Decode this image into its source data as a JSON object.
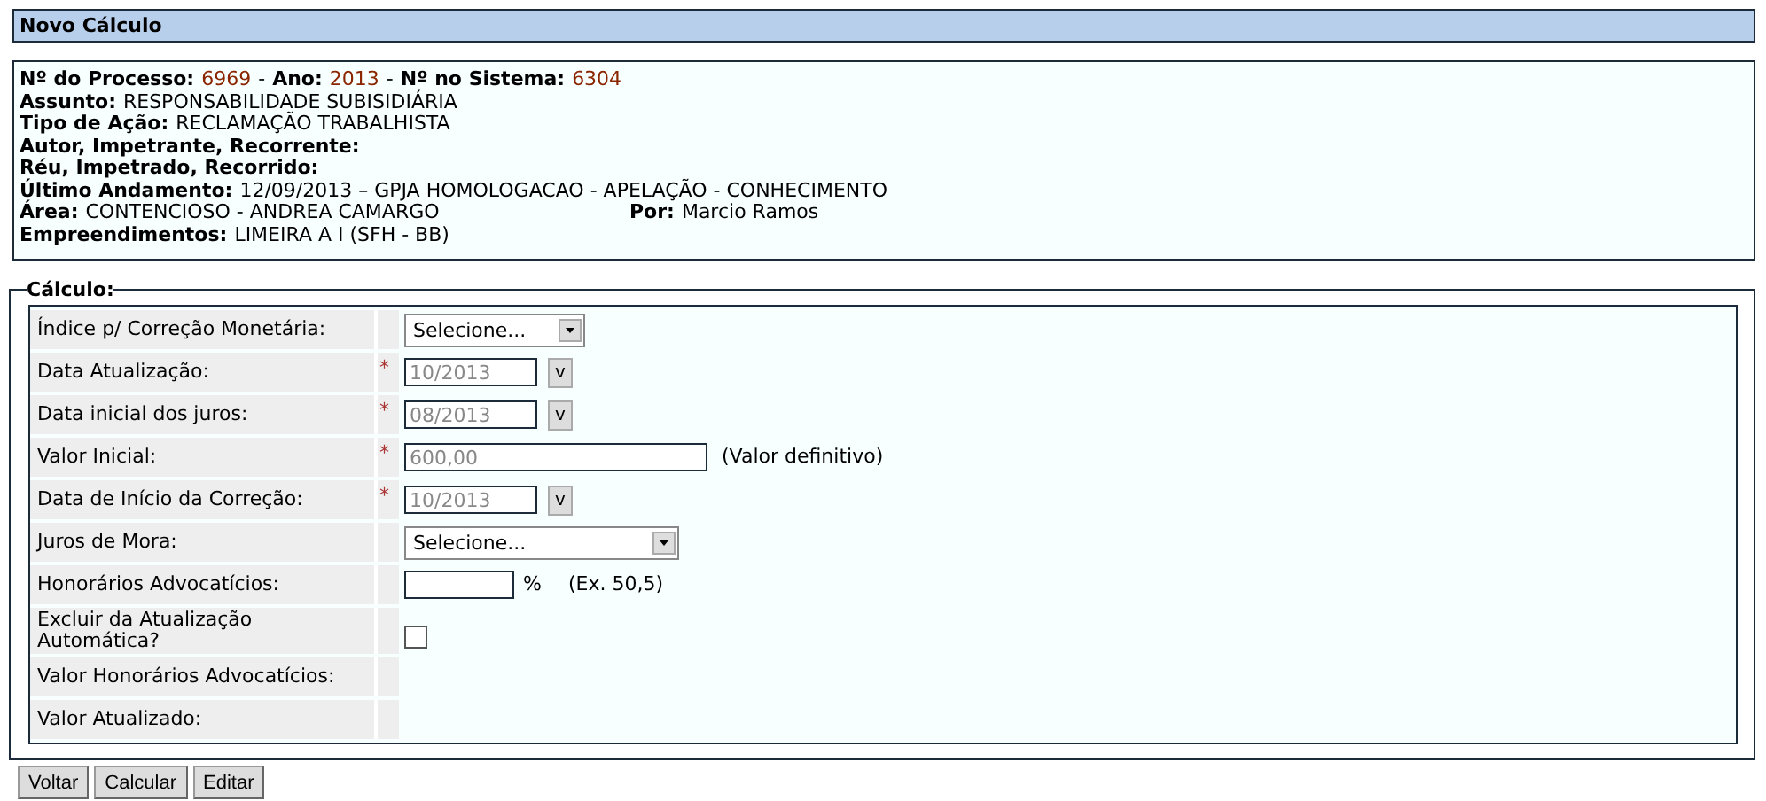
{
  "header": {
    "title": "Novo Cálculo"
  },
  "info": [
    {
      "parts": [
        {
          "kind": "label",
          "text": "Nº do Processo:"
        },
        {
          "kind": "ref",
          "text": "6969"
        },
        {
          "kind": "sep",
          "text": "-"
        },
        {
          "kind": "label",
          "text": "Ano:"
        },
        {
          "kind": "ref",
          "text": "2013"
        },
        {
          "kind": "sep",
          "text": "-"
        },
        {
          "kind": "label",
          "text": "Nº no Sistema:"
        },
        {
          "kind": "ref",
          "text": "6304"
        }
      ]
    },
    {
      "parts": [
        {
          "kind": "label",
          "text": "Assunto:"
        },
        {
          "kind": "value",
          "text": "RESPONSABILIDADE SUBISIDIÁRIA"
        }
      ]
    },
    {
      "parts": [
        {
          "kind": "label",
          "text": "Tipo de Ação:"
        },
        {
          "kind": "value",
          "text": "RECLAMAÇÃO TRABALHISTA"
        }
      ]
    },
    {
      "parts": [
        {
          "kind": "label",
          "text": "Autor, Impetrante, Recorrente:"
        }
      ]
    },
    {
      "parts": [
        {
          "kind": "label",
          "text": "Réu, Impetrado, Recorrido:"
        }
      ]
    },
    {
      "parts": [
        {
          "kind": "label",
          "text": "Último Andamento:"
        },
        {
          "kind": "value",
          "text": "12/09/2013 – GPJA HOMOLOGACAO - APELAÇÃO - CONHECIMENTO"
        }
      ]
    },
    {
      "parts": [
        {
          "kind": "label",
          "text": "Área:"
        },
        {
          "kind": "value",
          "text": "CONTENCIOSO - ANDREA CAMARGO"
        }
      ],
      "aside": [
        {
          "kind": "label",
          "text": "Por:"
        },
        {
          "kind": "value",
          "text": "Marcio Ramos"
        }
      ]
    },
    {
      "parts": [
        {
          "kind": "label",
          "text": "Empreendimentos:"
        },
        {
          "kind": "value",
          "text": "LIMEIRA A I (SFH - BB)"
        }
      ]
    }
  ],
  "form": {
    "legend": "Cálculo:",
    "required_mark": "*",
    "rows": [
      {
        "kind": "select",
        "label": "Índice p/ Correção Monetária:",
        "required": false,
        "value": "Selecione..."
      },
      {
        "kind": "date",
        "label": "Data Atualização:",
        "required": true,
        "value": "10/2013",
        "disabled": true,
        "button": "v"
      },
      {
        "kind": "date",
        "label": "Data inicial dos juros:",
        "required": true,
        "value": "08/2013",
        "disabled": true,
        "button": "v"
      },
      {
        "kind": "text",
        "label": "Valor Inicial:",
        "required": true,
        "value": "600,00",
        "disabled": true,
        "note": "(Valor definitivo)"
      },
      {
        "kind": "date",
        "label": "Data de Início da Correção:",
        "required": true,
        "value": "10/2013",
        "disabled": true,
        "button": "v"
      },
      {
        "kind": "wide-select",
        "label": "Juros de Mora:",
        "required": false,
        "value": "Selecione..."
      },
      {
        "kind": "percent",
        "label": "Honorários Advocatícios:",
        "required": false,
        "unit": "%",
        "note": "(Ex. 50,5)"
      },
      {
        "kind": "checkbox",
        "label": "Excluir da Atualização Automática?",
        "required": false,
        "checked": false
      },
      {
        "kind": "empty",
        "label": "Valor Honorários Advocatícios:",
        "required": false
      },
      {
        "kind": "empty",
        "label": "Valor Atualizado:",
        "required": false
      }
    ]
  },
  "buttons": [
    "Voltar",
    "Calcular",
    "Editar"
  ]
}
